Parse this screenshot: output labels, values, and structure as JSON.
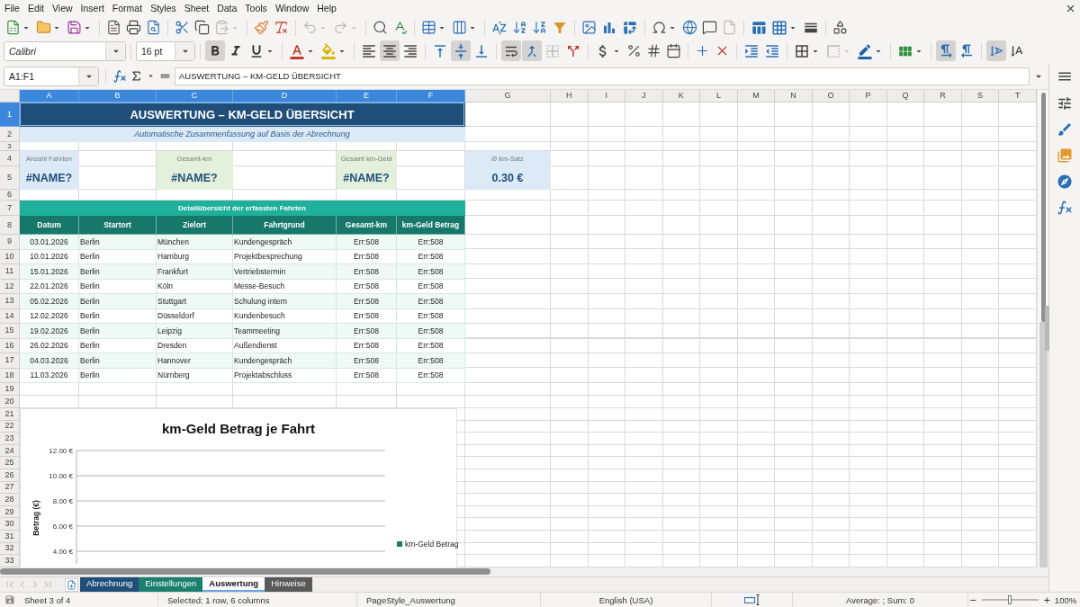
{
  "menu": [
    "File",
    "Edit",
    "View",
    "Insert",
    "Format",
    "Styles",
    "Sheet",
    "Data",
    "Tools",
    "Window",
    "Help"
  ],
  "standard_toolbar": [
    [
      {
        "kind": "new",
        "dropdown": true,
        "disabled": false
      },
      {
        "kind": "open",
        "dropdown": true,
        "disabled": false
      },
      {
        "kind": "save",
        "dropdown": true,
        "disabled": false
      }
    ],
    [
      {
        "kind": "pdf",
        "dropdown": false,
        "disabled": false
      },
      {
        "kind": "print",
        "dropdown": false,
        "disabled": false
      },
      {
        "kind": "preview",
        "dropdown": false,
        "disabled": false
      }
    ],
    [
      {
        "kind": "cut",
        "dropdown": false,
        "disabled": false
      },
      {
        "kind": "copy",
        "dropdown": false,
        "disabled": false
      },
      {
        "kind": "paste",
        "dropdown": true,
        "disabled": true
      }
    ],
    [
      {
        "kind": "clone",
        "dropdown": false,
        "disabled": false
      },
      {
        "kind": "clear",
        "dropdown": false,
        "disabled": false
      }
    ],
    [
      {
        "kind": "undo",
        "dropdown": true,
        "disabled": true
      },
      {
        "kind": "redo",
        "dropdown": true,
        "disabled": true
      }
    ],
    [
      {
        "kind": "find",
        "dropdown": false,
        "disabled": false
      },
      {
        "kind": "spelling",
        "dropdown": false,
        "disabled": false
      }
    ],
    [
      {
        "kind": "rows",
        "dropdown": true,
        "disabled": false
      },
      {
        "kind": "columns",
        "dropdown": true,
        "disabled": false
      }
    ],
    [
      {
        "kind": "sort",
        "dropdown": false,
        "disabled": false
      },
      {
        "kind": "ascending",
        "dropdown": false,
        "disabled": false
      },
      {
        "kind": "descending",
        "dropdown": false,
        "disabled": false
      },
      {
        "kind": "filter",
        "dropdown": false,
        "disabled": false
      }
    ],
    [
      {
        "kind": "image",
        "dropdown": false,
        "disabled": false
      },
      {
        "kind": "chart",
        "dropdown": false,
        "disabled": false
      },
      {
        "kind": "pivot",
        "dropdown": false,
        "disabled": false
      }
    ],
    [
      {
        "kind": "symbol",
        "dropdown": true,
        "disabled": false
      },
      {
        "kind": "link",
        "dropdown": false,
        "disabled": false
      },
      {
        "kind": "comment",
        "dropdown": false,
        "disabled": false
      },
      {
        "kind": "header",
        "dropdown": false,
        "disabled": true
      }
    ],
    [
      {
        "kind": "printarea",
        "dropdown": false,
        "disabled": false
      },
      {
        "kind": "freeze",
        "dropdown": true,
        "disabled": false
      },
      {
        "kind": "split",
        "dropdown": false,
        "disabled": false
      }
    ],
    [
      {
        "kind": "draw",
        "dropdown": false,
        "disabled": false
      }
    ]
  ],
  "formatting_toolbar": {
    "font_name": "Calibri",
    "font_size": "16 pt",
    "groups": [
      [
        {
          "kind": "bold",
          "pressed": true,
          "dropdown": false,
          "disabled": false
        },
        {
          "kind": "italic",
          "pressed": false,
          "dropdown": false,
          "disabled": false
        },
        {
          "kind": "underline",
          "pressed": false,
          "dropdown": true,
          "disabled": false
        }
      ],
      [
        {
          "kind": "fontcolor",
          "pressed": false,
          "dropdown": true,
          "disabled": false
        },
        {
          "kind": "highlight",
          "pressed": false,
          "dropdown": true,
          "disabled": false
        }
      ],
      [
        {
          "kind": "left",
          "pressed": false,
          "dropdown": false,
          "disabled": false
        },
        {
          "kind": "center",
          "pressed": true,
          "dropdown": false,
          "disabled": false
        },
        {
          "kind": "right",
          "pressed": false,
          "dropdown": false,
          "disabled": false
        }
      ],
      [
        {
          "kind": "top",
          "pressed": false,
          "dropdown": false,
          "disabled": false
        },
        {
          "kind": "middle",
          "pressed": true,
          "dropdown": false,
          "disabled": false
        },
        {
          "kind": "bottom",
          "pressed": false,
          "dropdown": false,
          "disabled": false
        }
      ],
      [
        {
          "kind": "wrap",
          "pressed": true,
          "dropdown": false,
          "disabled": false
        },
        {
          "kind": "mergecenter",
          "pressed": true,
          "dropdown": false,
          "disabled": false
        },
        {
          "kind": "merge",
          "pressed": false,
          "dropdown": false,
          "disabled": true
        },
        {
          "kind": "unmerge",
          "pressed": false,
          "dropdown": false,
          "disabled": false
        }
      ],
      [
        {
          "kind": "currency",
          "pressed": false,
          "dropdown": true,
          "disabled": false
        },
        {
          "kind": "percent",
          "pressed": false,
          "dropdown": false,
          "disabled": false
        },
        {
          "kind": "number",
          "pressed": false,
          "dropdown": false,
          "disabled": false
        },
        {
          "kind": "date",
          "pressed": false,
          "dropdown": false,
          "disabled": false
        }
      ],
      [
        {
          "kind": "adddecimal",
          "pressed": false,
          "dropdown": false,
          "disabled": false
        },
        {
          "kind": "deldecimal",
          "pressed": false,
          "dropdown": false,
          "disabled": false
        }
      ],
      [
        {
          "kind": "indent",
          "pressed": false,
          "dropdown": false,
          "disabled": false
        },
        {
          "kind": "outdent",
          "pressed": false,
          "dropdown": false,
          "disabled": false
        }
      ],
      [
        {
          "kind": "borders",
          "pressed": false,
          "dropdown": true,
          "disabled": false
        },
        {
          "kind": "borderstyle",
          "pressed": false,
          "dropdown": true,
          "disabled": true
        },
        {
          "kind": "bordercolor",
          "pressed": false,
          "dropdown": true,
          "disabled": false
        }
      ],
      [
        {
          "kind": "conditional",
          "pressed": false,
          "dropdown": true,
          "disabled": false
        }
      ],
      [
        {
          "kind": "ltr",
          "pressed": true,
          "dropdown": false,
          "disabled": false
        },
        {
          "kind": "rtl",
          "pressed": false,
          "dropdown": false,
          "disabled": false
        }
      ],
      [
        {
          "kind": "rotate",
          "pressed": true,
          "dropdown": false,
          "disabled": false
        },
        {
          "kind": "stacked",
          "pressed": false,
          "dropdown": false,
          "disabled": false
        }
      ]
    ]
  },
  "formula_bar": {
    "name_box": "A1:F1",
    "content": "AUSWERTUNG – KM-GELD ÜBERSICHT"
  },
  "sheet": {
    "columns": [
      {
        "label": "A",
        "selected": true
      },
      {
        "label": "B",
        "selected": true
      },
      {
        "label": "C",
        "selected": true
      },
      {
        "label": "D",
        "selected": true
      },
      {
        "label": "E",
        "selected": true
      },
      {
        "label": "F",
        "selected": true
      },
      {
        "label": "G",
        "selected": false
      },
      {
        "label": "H",
        "selected": false
      },
      {
        "label": "I",
        "selected": false
      },
      {
        "label": "J",
        "selected": false
      },
      {
        "label": "K",
        "selected": false
      },
      {
        "label": "L",
        "selected": false
      },
      {
        "label": "M",
        "selected": false
      },
      {
        "label": "N",
        "selected": false
      },
      {
        "label": "O",
        "selected": false
      },
      {
        "label": "P",
        "selected": false
      },
      {
        "label": "Q",
        "selected": false
      },
      {
        "label": "R",
        "selected": false
      },
      {
        "label": "S",
        "selected": false
      },
      {
        "label": "T",
        "selected": false
      }
    ],
    "rows": [
      {
        "label": "1",
        "selected": true
      },
      {
        "label": "2",
        "selected": false
      },
      {
        "label": "3",
        "selected": false
      },
      {
        "label": "4",
        "selected": false
      },
      {
        "label": "5",
        "selected": false
      },
      {
        "label": "6",
        "selected": false
      },
      {
        "label": "7",
        "selected": false
      },
      {
        "label": "8",
        "selected": false
      },
      {
        "label": "9",
        "selected": false
      },
      {
        "label": "10",
        "selected": false
      },
      {
        "label": "11",
        "selected": false
      },
      {
        "label": "12",
        "selected": false
      },
      {
        "label": "13",
        "selected": false
      },
      {
        "label": "14",
        "selected": false
      },
      {
        "label": "15",
        "selected": false
      },
      {
        "label": "16",
        "selected": false
      },
      {
        "label": "17",
        "selected": false
      },
      {
        "label": "18",
        "selected": false
      },
      {
        "label": "19",
        "selected": false
      },
      {
        "label": "20",
        "selected": false
      },
      {
        "label": "21",
        "selected": false
      },
      {
        "label": "22",
        "selected": false
      },
      {
        "label": "23",
        "selected": false
      },
      {
        "label": "24",
        "selected": false
      },
      {
        "label": "25",
        "selected": false
      },
      {
        "label": "26",
        "selected": false
      },
      {
        "label": "27",
        "selected": false
      },
      {
        "label": "28",
        "selected": false
      },
      {
        "label": "29",
        "selected": false
      },
      {
        "label": "30",
        "selected": false
      },
      {
        "label": "31",
        "selected": false
      },
      {
        "label": "32",
        "selected": false
      },
      {
        "label": "33",
        "selected": false
      }
    ],
    "title": "AUSWERTUNG – KM-GELD ÜBERSICHT",
    "subtitle": "Automatische Zusammenfassung auf Basis der Abrechnung",
    "summary": [
      {
        "label": "Anzahl Fahrten",
        "value": "#NAME?",
        "color": "#dce9f6"
      },
      {
        "label": "Gesamt-km",
        "value": "#NAME?",
        "color": "#e3f0dc"
      },
      {
        "label": "Gesamt km-Geld",
        "value": "#NAME?",
        "color": "#e3f0dc"
      },
      {
        "label": "Ø km-Satz",
        "value": "0.30 €",
        "color": "#dce9f6"
      }
    ],
    "section_title": "Detailübersicht der erfassten Fahrten",
    "table": {
      "columns": [
        "Datum",
        "Startort",
        "Zielort",
        "Fahrtgrund",
        "Gesamt-km",
        "km-Geld Betrag"
      ],
      "rows": [
        [
          "03.01.2026",
          "Berlin",
          "München",
          "Kundengespräch",
          "Err:508",
          "Err:508"
        ],
        [
          "10.01.2026",
          "Berlin",
          "Hamburg",
          "Projektbesprechung",
          "Err:508",
          "Err:508"
        ],
        [
          "15.01.2026",
          "Berlin",
          "Frankfurt",
          "Vertriebstermin",
          "Err:508",
          "Err:508"
        ],
        [
          "22.01.2026",
          "Berlin",
          "Köln",
          "Messe-Besuch",
          "Err:508",
          "Err:508"
        ],
        [
          "05.02.2026",
          "Berlin",
          "Stuttgart",
          "Schulung intern",
          "Err:508",
          "Err:508"
        ],
        [
          "12.02.2026",
          "Berlin",
          "Düsseldorf",
          "Kundenbesuch",
          "Err:508",
          "Err:508"
        ],
        [
          "19.02.2026",
          "Berlin",
          "Leipzig",
          "Teammeeting",
          "Err:508",
          "Err:508"
        ],
        [
          "26.02.2026",
          "Berlin",
          "Dresden",
          "Außendienst",
          "Err:508",
          "Err:508"
        ],
        [
          "04.03.2026",
          "Berlin",
          "Hannover",
          "Kundengespräch",
          "Err:508",
          "Err:508"
        ],
        [
          "11.03.2026",
          "Berlin",
          "Nürnberg",
          "Projektabschluss",
          "Err:508",
          "Err:508"
        ]
      ]
    },
    "chart": {
      "chart_data": {
        "type": "bar",
        "title": "km-Geld Betrag je Fahrt",
        "ylabel": "Betrag (€)",
        "series": [
          {
            "name": "km-Geld Betrag",
            "color": "#1b7a68"
          }
        ],
        "ylim": [
          4,
          12
        ],
        "yticks": [
          {
            "value": 12,
            "label": "12.00 €"
          },
          {
            "value": 10,
            "label": "10.00 €"
          },
          {
            "value": 8,
            "label": "8.00 €"
          },
          {
            "value": 6,
            "label": "6.00 €"
          },
          {
            "value": 4,
            "label": "4.00 €"
          }
        ],
        "grid": true
      }
    }
  },
  "sheet_tabs": {
    "navigation": {
      "disabled": true
    },
    "tabs": [
      {
        "label": "Abrechnung",
        "selected": false,
        "color": "#1f4e79"
      },
      {
        "label": "Einstellungen",
        "selected": false,
        "color": "#1a7f6e"
      },
      {
        "label": "Auswertung",
        "selected": true
      },
      {
        "label": "Hinweise",
        "selected": false,
        "color": "#595959"
      }
    ]
  },
  "status_bar": {
    "sheet": "Sheet 3 of 4",
    "selection": "Selected: 1 row, 6 columns",
    "page_style": "PageStyle_Auswertung",
    "language": "English (USA)",
    "summary": "Average: ; Sum: 0",
    "zoom": {
      "level": 0.5,
      "reading": "100%"
    }
  }
}
